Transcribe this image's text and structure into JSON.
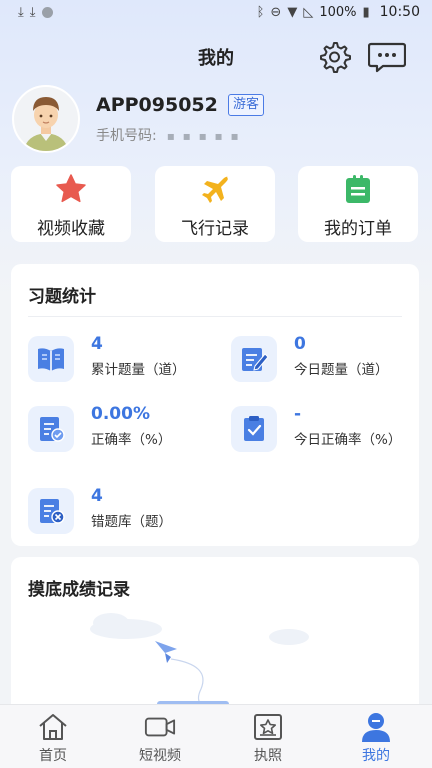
{
  "status_bar": {
    "left_icons": [
      "download-icon",
      "download-icon",
      "dot-icon"
    ],
    "right_icons": [
      "bluetooth-icon",
      "dnd-icon",
      "wifi-icon",
      "no-signal-icon"
    ],
    "battery": "100%",
    "time": "10:50"
  },
  "header": {
    "title": "我的",
    "settings_icon": "gear-icon",
    "message_icon": "message-icon"
  },
  "profile": {
    "username": "APP095052",
    "badge": "游客",
    "phone_label": "手机号码:",
    "phone_mask": "▪ ▪ ▪ ▪ ▪"
  },
  "quick_actions": [
    {
      "label": "视频收藏",
      "icon": "star-icon"
    },
    {
      "label": "飞行记录",
      "icon": "airplane-icon"
    },
    {
      "label": "我的订单",
      "icon": "clipboard-icon"
    }
  ],
  "stats": {
    "title": "习题统计",
    "items": [
      {
        "value": "4",
        "label": "累计题量（道）",
        "icon": "book-icon"
      },
      {
        "value": "0",
        "label": "今日题量（道）",
        "icon": "edit-icon"
      },
      {
        "value": "0.00%",
        "label": "正确率（%）",
        "icon": "check-doc-icon"
      },
      {
        "value": "-",
        "label": "今日正确率（%）",
        "icon": "check-clipboard-icon"
      },
      {
        "value": "4",
        "label": "错题库（题）",
        "icon": "wrong-doc-icon"
      }
    ]
  },
  "exam": {
    "title": "摸底成绩记录"
  },
  "bottom_nav": [
    {
      "label": "首页",
      "icon": "home-icon",
      "active": false
    },
    {
      "label": "短视频",
      "icon": "video-icon",
      "active": false
    },
    {
      "label": "执照",
      "icon": "license-icon",
      "active": false
    },
    {
      "label": "我的",
      "icon": "user-icon",
      "active": true
    }
  ],
  "colors": {
    "accent": "#3d76e0",
    "star": "#e85a4f",
    "airplane": "#f3b21d",
    "clipboard": "#3cb868"
  }
}
